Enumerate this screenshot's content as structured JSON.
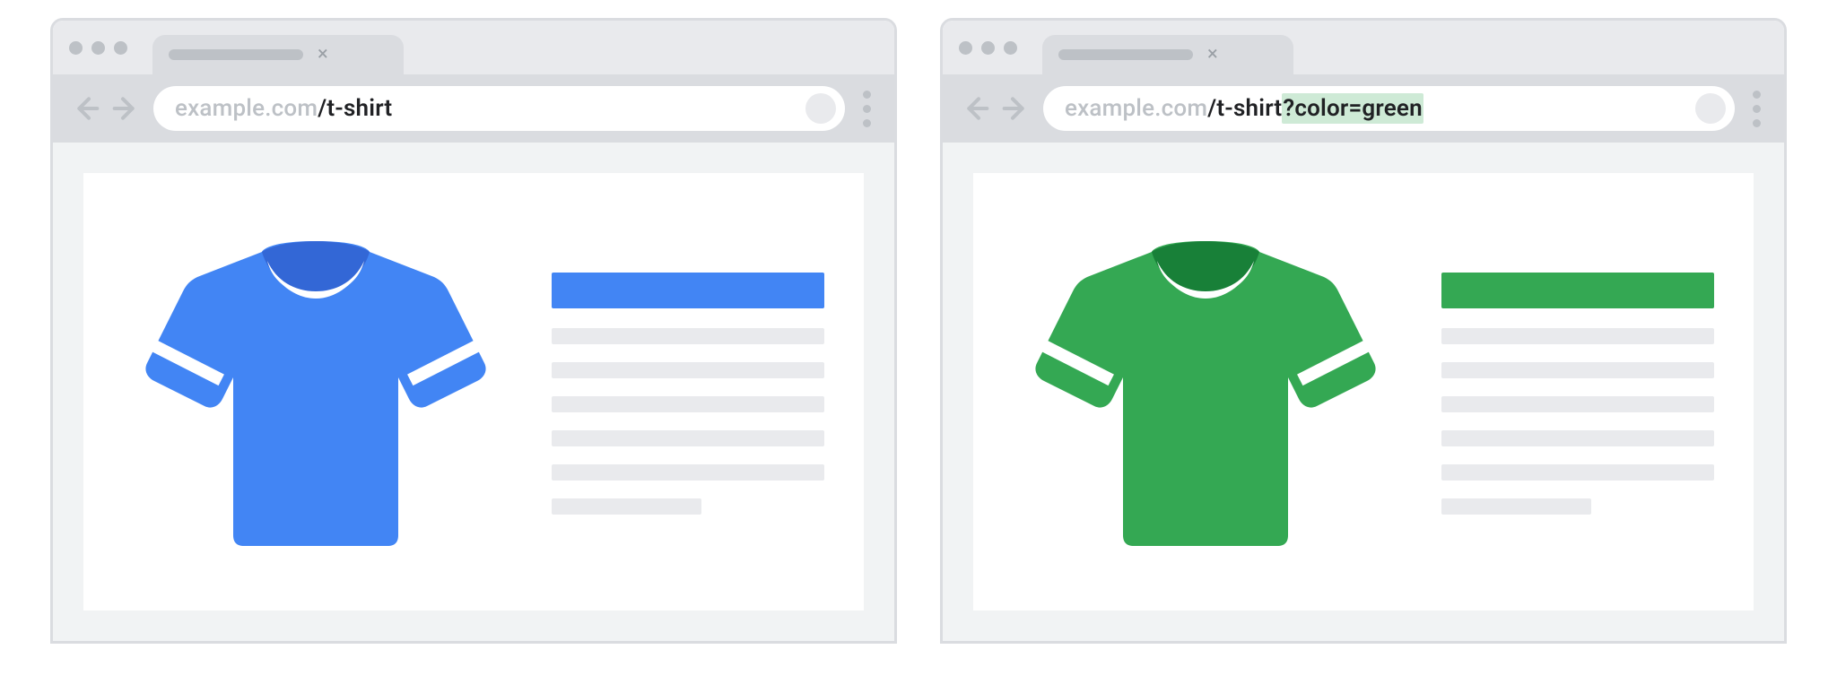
{
  "browsers": [
    {
      "id": "left",
      "url": {
        "domain": "example.com",
        "path": "/t-shirt",
        "query_highlight": ""
      },
      "product_color": "#4285f4",
      "product_color_dark": "#3367d6",
      "icon_name": "tshirt-blue-icon"
    },
    {
      "id": "right",
      "url": {
        "domain": "example.com",
        "path": "/t-shirt",
        "query_highlight": "?color=green"
      },
      "product_color": "#34a853",
      "product_color_dark": "#188038",
      "icon_name": "tshirt-green-icon"
    }
  ]
}
